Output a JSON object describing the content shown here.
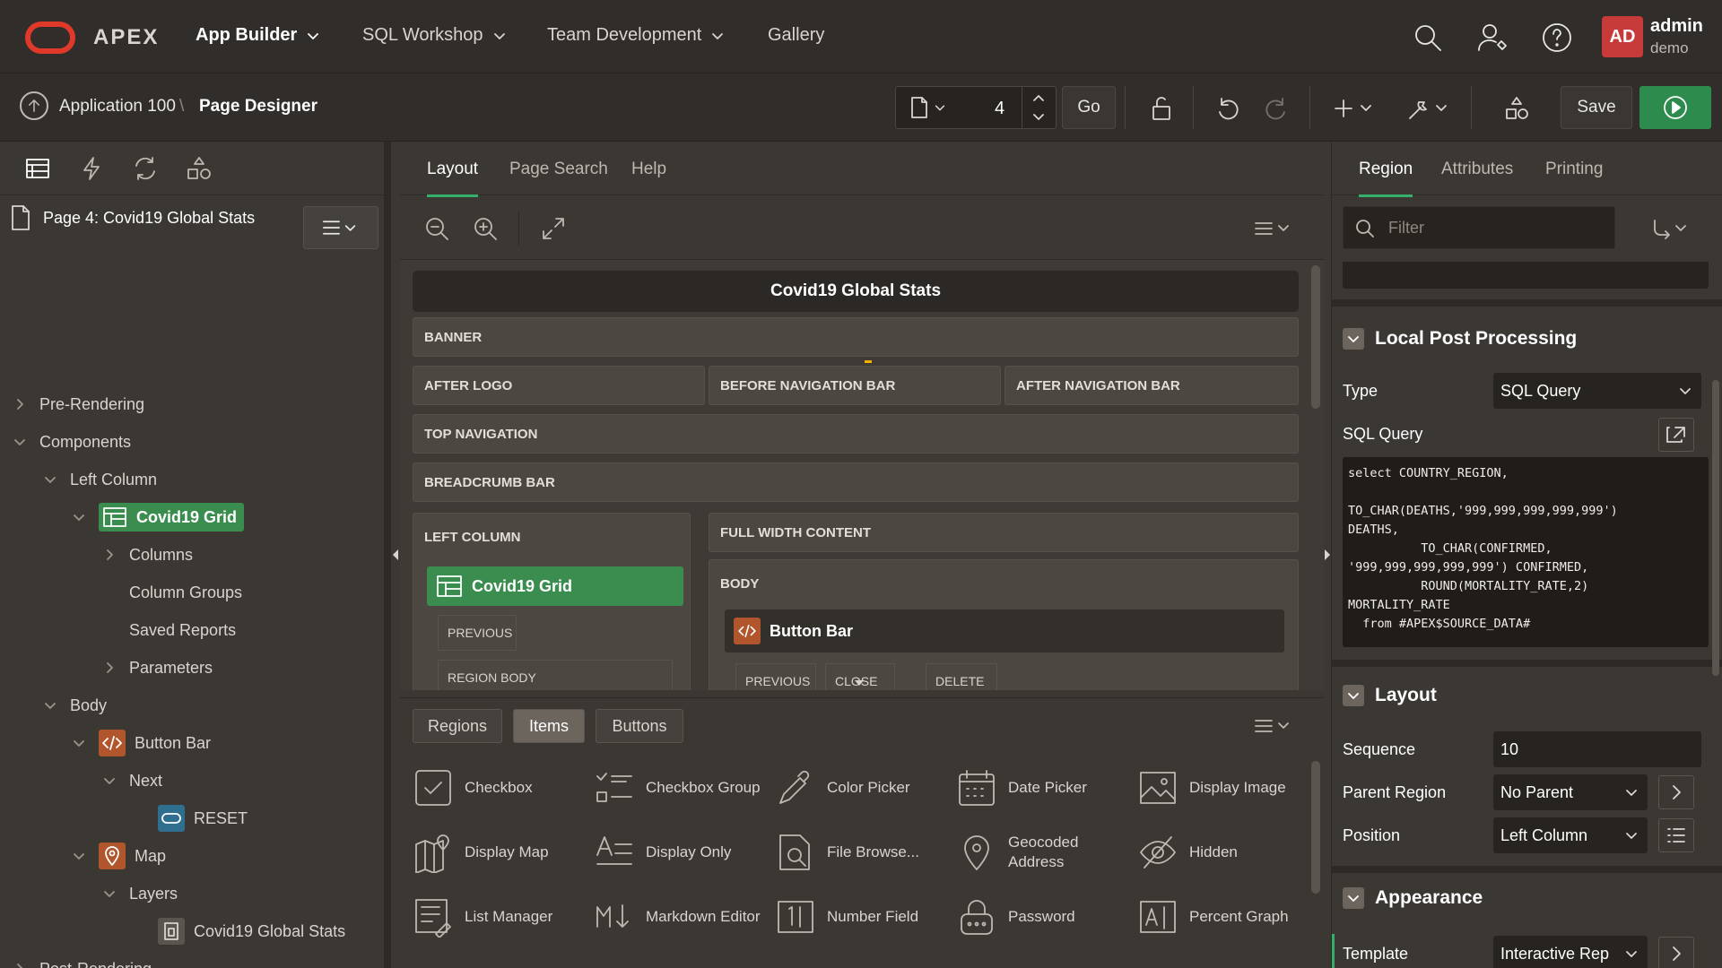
{
  "topnav": {
    "brand": "APEX",
    "items": [
      {
        "label": "App Builder",
        "active": true
      },
      {
        "label": "SQL Workshop",
        "active": false
      },
      {
        "label": "Team Development",
        "active": false
      },
      {
        "label": "Gallery",
        "active": false
      }
    ],
    "user": {
      "initials": "AD",
      "name": "admin",
      "workspace": "demo"
    }
  },
  "toolbar": {
    "breadcrumb_app": "Application 100",
    "breadcrumb_page": "Page Designer",
    "page_number": "4",
    "go_label": "Go",
    "save_label": "Save"
  },
  "left_panel": {
    "page_title": "Page 4: Covid19 Global Stats",
    "tree": {
      "pre_rendering": "Pre-Rendering",
      "components": "Components",
      "left_column": "Left Column",
      "covid19_grid": "Covid19 Grid",
      "columns": "Columns",
      "column_groups": "Column Groups",
      "saved_reports": "Saved Reports",
      "parameters": "Parameters",
      "body": "Body",
      "button_bar": "Button Bar",
      "next": "Next",
      "reset": "RESET",
      "map": "Map",
      "layers": "Layers",
      "layer_global_stats": "Covid19 Global Stats",
      "post_rendering": "Post-Rendering"
    }
  },
  "center": {
    "tabs": [
      "Layout",
      "Page Search",
      "Help"
    ],
    "page_title": "Covid19 Global Stats",
    "slots": {
      "banner": "BANNER",
      "after_logo": "AFTER LOGO",
      "before_nav_bar": "BEFORE NAVIGATION BAR",
      "after_nav_bar": "AFTER NAVIGATION BAR",
      "top_navigation": "TOP NAVIGATION",
      "breadcrumb_bar": "BREADCRUMB BAR",
      "left_column": "LEFT COLUMN",
      "full_width_content": "FULL WIDTH CONTENT",
      "body": "BODY",
      "previous": "PREVIOUS",
      "region_body": "REGION BODY",
      "bb_previous": "PREVIOUS",
      "bb_close": "CLOSE",
      "bb_delete": "DELETE"
    },
    "components": {
      "covid19_grid": "Covid19 Grid",
      "button_bar": "Button Bar"
    },
    "gallery_tabs": [
      "Regions",
      "Items",
      "Buttons"
    ],
    "gallery_items": [
      {
        "label": "Checkbox",
        "icon": "checkbox-icon"
      },
      {
        "label": "Checkbox Group",
        "icon": "checkbox-group-icon"
      },
      {
        "label": "Color Picker",
        "icon": "color-picker-icon"
      },
      {
        "label": "Date Picker",
        "icon": "date-picker-icon"
      },
      {
        "label": "Display Image",
        "icon": "display-image-icon"
      },
      {
        "label": "Display Map",
        "icon": "display-map-icon"
      },
      {
        "label": "Display Only",
        "icon": "display-only-icon"
      },
      {
        "label": "File Browse...",
        "icon": "file-browse-icon"
      },
      {
        "label": "Geocoded Address",
        "icon": "geocoded-address-icon"
      },
      {
        "label": "Hidden",
        "icon": "hidden-icon"
      },
      {
        "label": "List Manager",
        "icon": "list-manager-icon"
      },
      {
        "label": "Markdown Editor",
        "icon": "markdown-editor-icon"
      },
      {
        "label": "Number Field",
        "icon": "number-field-icon"
      },
      {
        "label": "Password",
        "icon": "password-icon"
      },
      {
        "label": "Percent Graph",
        "icon": "percent-graph-icon"
      }
    ]
  },
  "right_panel": {
    "tabs": [
      "Region",
      "Attributes",
      "Printing"
    ],
    "filter_placeholder": "Filter",
    "local_post_processing": {
      "heading": "Local Post Processing",
      "type_label": "Type",
      "type_value": "SQL Query",
      "sql_label": "SQL Query",
      "sql_value": "select COUNTRY_REGION,\n\nTO_CHAR(DEATHS,'999,999,999,999,999')\nDEATHS,\n          TO_CHAR(CONFIRMED,\n'999,999,999,999,999') CONFIRMED,\n          ROUND(MORTALITY_RATE,2)\nMORTALITY_RATE\n  from #APEX$SOURCE_DATA#"
    },
    "layout": {
      "heading": "Layout",
      "sequence_label": "Sequence",
      "sequence_value": "10",
      "parent_label": "Parent Region",
      "parent_value": "No Parent",
      "position_label": "Position",
      "position_value": "Left Column"
    },
    "appearance": {
      "heading": "Appearance",
      "template_label": "Template",
      "template_value": "Interactive Rep"
    }
  },
  "colors": {
    "accent_green": "#35b06a",
    "selected_green": "#3a8d4e",
    "oracle_red": "#e0392a",
    "run_green": "#2e8b4e"
  }
}
